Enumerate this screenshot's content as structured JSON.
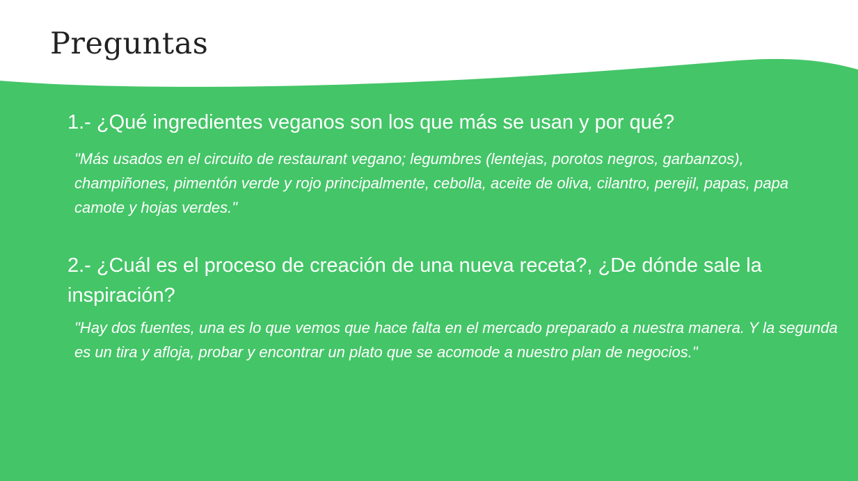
{
  "slide": {
    "title": "Preguntas",
    "background_color": "#ffffff",
    "accent_color": "#44c568",
    "text_color_on_accent": "#ffffff",
    "title_color": "#222222"
  },
  "questions": [
    {
      "question": "1.- ¿Qué ingredientes veganos son los que más se usan y por qué?",
      "answer": "\"Más usados en el circuito de restaurant vegano; legumbres (lentejas, porotos negros, garbanzos), champiñones, pimentón verde y rojo principalmente, cebolla, aceite de oliva, cilantro, perejil, papas, papa camote y hojas verdes.\""
    },
    {
      "question": "2.- ¿Cuál es el proceso de creación de una nueva receta?, ¿De dónde sale la inspiración?",
      "answer": "\"Hay dos fuentes, una es lo que vemos que hace falta en el mercado preparado a nuestra manera. Y la segunda es un tira y afloja, probar y encontrar un plato que se acomode a nuestro plan de negocios.\""
    }
  ]
}
